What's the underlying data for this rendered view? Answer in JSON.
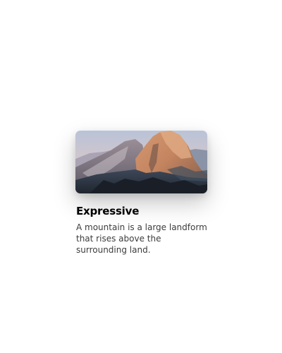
{
  "card": {
    "title": "Expressive",
    "description": "A mountain is a large landform that rises above the surrounding land.",
    "image": "mountain-photo"
  },
  "colors": {
    "title": "#000000",
    "description": "#3c3c3c",
    "background": "#ffffff"
  }
}
